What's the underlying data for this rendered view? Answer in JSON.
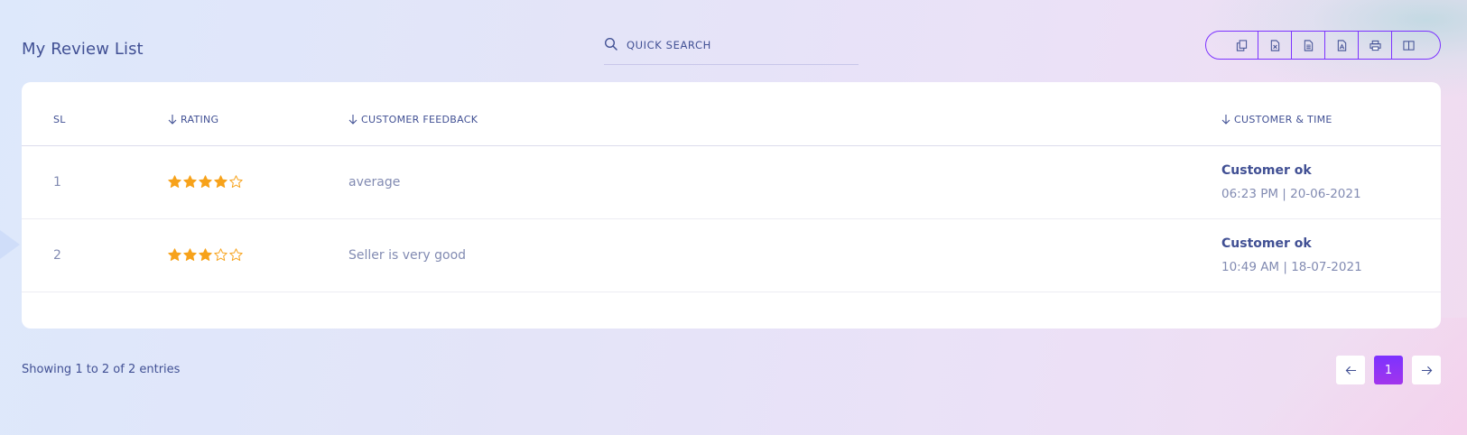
{
  "page": {
    "title": "My Review List"
  },
  "search": {
    "placeholder": "QUICK SEARCH"
  },
  "toolbar": {
    "buttons": [
      {
        "icon": "copy-icon"
      },
      {
        "icon": "excel-icon"
      },
      {
        "icon": "csv-icon"
      },
      {
        "icon": "pdf-icon"
      },
      {
        "icon": "print-icon"
      },
      {
        "icon": "columns-icon"
      }
    ]
  },
  "table": {
    "headers": {
      "sl": "SL",
      "rating": "RATING",
      "feedback": "CUSTOMER FEEDBACK",
      "customer_time": "CUSTOMER & TIME"
    },
    "rows": [
      {
        "sl": "1",
        "rating": 4,
        "max_rating": 5,
        "feedback": "average",
        "customer": "Customer ok",
        "time": "06:23 PM | 20-06-2021"
      },
      {
        "sl": "2",
        "rating": 3,
        "max_rating": 5,
        "feedback": "Seller is very good",
        "customer": "Customer ok",
        "time": "10:49 AM | 18-07-2021"
      }
    ]
  },
  "footer": {
    "entries_text": "Showing 1 to 2 of 2 entries",
    "current_page": "1"
  },
  "colors": {
    "accent": "#7c32ff",
    "star": "#f7a21a",
    "text_dark": "#415094",
    "text_muted": "#828bb2"
  }
}
